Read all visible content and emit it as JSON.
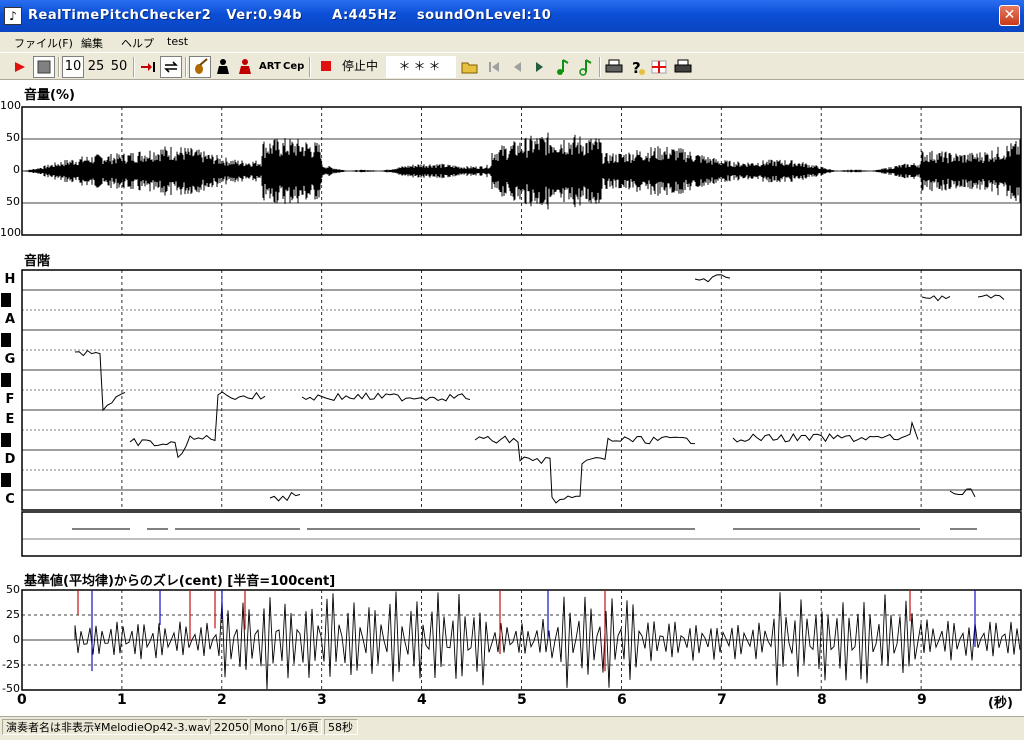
{
  "window": {
    "title": "RealTimePitchChecker2   Ver:0.94b      A:445Hz    soundOnLevel:10",
    "icon": "violin-app-icon",
    "close_label": "✕"
  },
  "menu": {
    "items": [
      "ファイル(F)",
      "編集",
      "ヘルプ",
      "test"
    ]
  },
  "toolbar": {
    "speed_10": "10",
    "speed_25": "25",
    "speed_50": "50",
    "art_label": "ART",
    "cep_label": "Cep",
    "status_label": "停止中",
    "pitch_readout": "＊＊＊"
  },
  "volume_panel": {
    "label": "音量(%)",
    "y_ticks": [
      "100",
      "50",
      "0",
      "50",
      "100"
    ]
  },
  "pitch_panel": {
    "label": "音階",
    "notes": [
      "H",
      "A",
      "G",
      "F",
      "E",
      "D",
      "C"
    ]
  },
  "cent_panel": {
    "label": "基準値(平均律)からのズレ(cent) [半音=100cent]",
    "y_ticks": [
      "50",
      "25",
      "0",
      "-25",
      "-50"
    ]
  },
  "x_axis": {
    "ticks": [
      "0",
      "1",
      "2",
      "3",
      "4",
      "5",
      "6",
      "7",
      "8",
      "9"
    ],
    "unit": "(秒)"
  },
  "statusbar": {
    "file": "演奏者名は非表示¥MelodieOp42-3.wav",
    "rate": "22050",
    "channels": "Mono",
    "page": "1/6頁",
    "duration": "58秒"
  },
  "chart_data": {
    "type": "line",
    "x_range": [
      0,
      10
    ],
    "volume_range": [
      -100,
      100
    ],
    "cent_range": [
      -50,
      50
    ],
    "grid": true
  }
}
